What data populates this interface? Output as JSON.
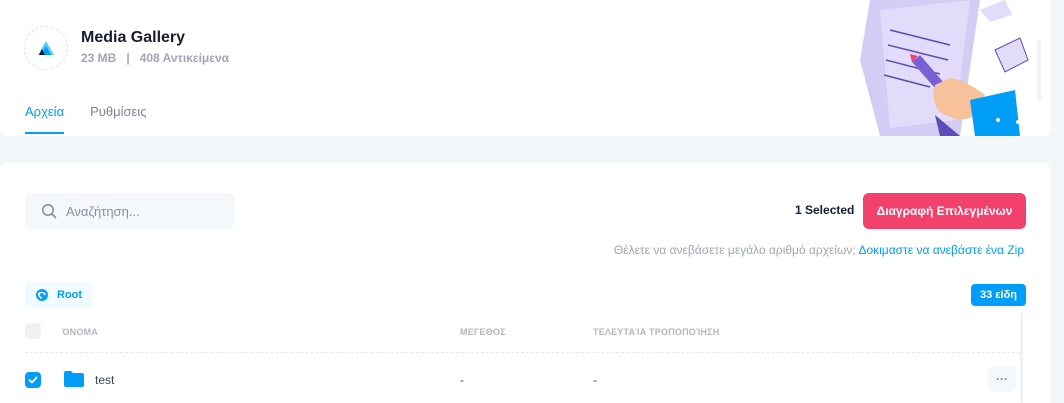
{
  "app": {
    "title": "Media Gallery",
    "size": "23 MB",
    "separator": "|",
    "items_count": "408 Αντικείμενα"
  },
  "tabs": [
    {
      "label": "Αρχεία",
      "active": true
    },
    {
      "label": "Ρυθμίσεις",
      "active": false
    }
  ],
  "toolbar": {
    "search_placeholder": "Αναζήτηση...",
    "selected_text": "1 Selected",
    "delete_label": "Διαγραφή Επιλεγμένων"
  },
  "zip_hint": {
    "text": "Θέλετε να ανεβάσετε μεγάλο αριθμό αρχείων;",
    "link": "Δοκιμαστε να ανεβάστε ένα Zip"
  },
  "breadcrumb": {
    "root_label": "Root"
  },
  "badge": {
    "items_label": "33 είδη"
  },
  "table": {
    "columns": [
      "ΌΝΟΜΑ",
      "ΜΕΓΕΘΟΣ",
      "ΤΕΛΕΥΤΑΊΑ ΤΡΟΠΟΠΟΊΗΣΗ"
    ],
    "rows": [
      {
        "name": "test",
        "size": "-",
        "modified": "-",
        "checked": true,
        "actions": "···"
      }
    ]
  },
  "colors": {
    "primary": "#009ef7",
    "danger": "#f1416c",
    "background": "#f3f6f9"
  },
  "icons": [
    "logo-icon",
    "search-icon",
    "root-icon",
    "folder-icon",
    "check-icon",
    "more-icon",
    "illustration"
  ]
}
